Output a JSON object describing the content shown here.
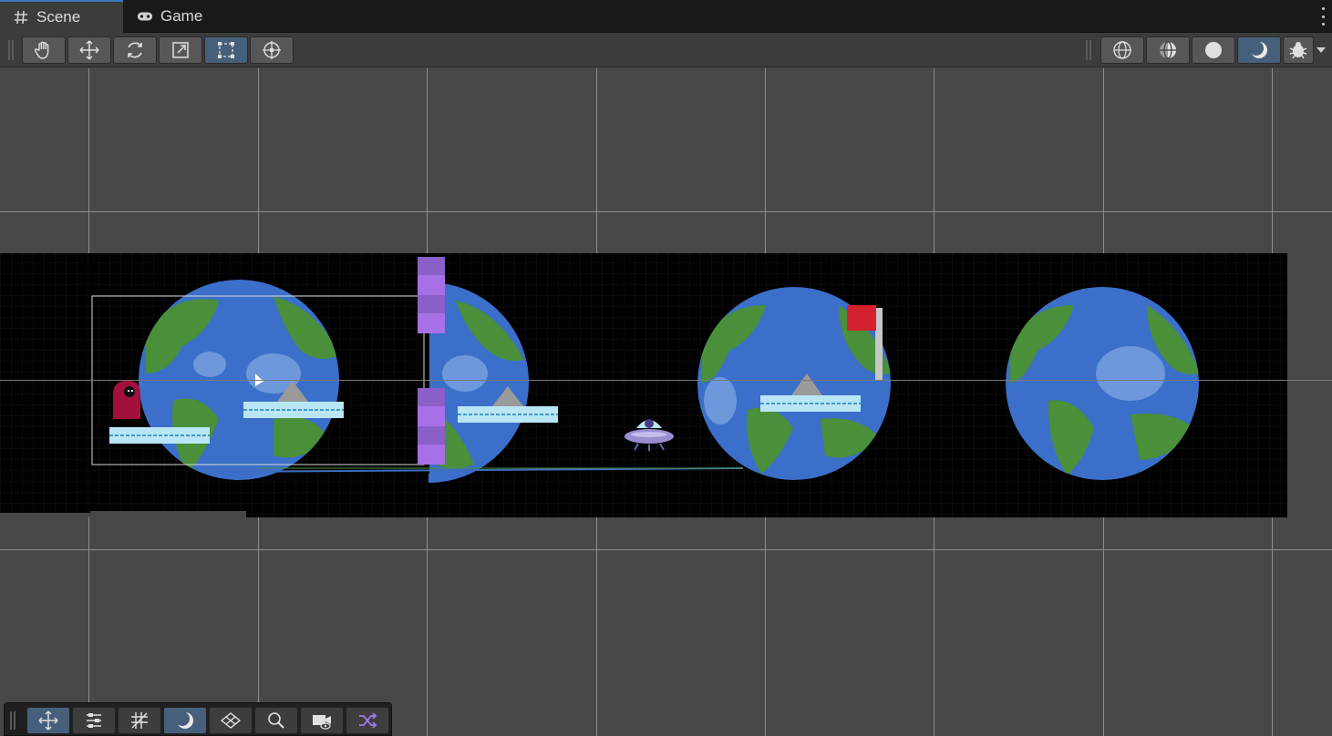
{
  "tabs": [
    {
      "label": "Scene",
      "icon": "hash-icon",
      "active": true
    },
    {
      "label": "Game",
      "icon": "gamepad-icon",
      "active": false
    }
  ],
  "toolbar": {
    "left_tools": [
      {
        "name": "hand-tool",
        "icon": "hand-icon",
        "active": false
      },
      {
        "name": "move-tool",
        "icon": "move-arrows-icon",
        "active": false
      },
      {
        "name": "rotate-tool",
        "icon": "rotate-icon",
        "active": false
      },
      {
        "name": "scale-tool",
        "icon": "scale-icon",
        "active": false
      },
      {
        "name": "rect-tool",
        "icon": "rect-transform-icon",
        "active": true
      },
      {
        "name": "transform-tool",
        "icon": "transform-icon",
        "active": false
      }
    ],
    "right_tools": [
      {
        "name": "wireframe-shading",
        "icon": "wireframe-sphere-icon",
        "active": false
      },
      {
        "name": "shaded-wireframe",
        "icon": "shaded-wireframe-icon",
        "active": false
      },
      {
        "name": "shaded",
        "icon": "solid-sphere-icon",
        "active": false
      },
      {
        "name": "unlit",
        "icon": "crescent-icon",
        "active": true
      },
      {
        "name": "debug-draw",
        "icon": "bug-icon",
        "active": false
      }
    ]
  },
  "overlay_toolbar": [
    {
      "name": "move-tool-overlay",
      "icon": "move-arrows-icon",
      "active": true
    },
    {
      "name": "tool-settings",
      "icon": "sliders-icon",
      "active": false
    },
    {
      "name": "grid-snapping",
      "icon": "grid-snap-icon",
      "active": false
    },
    {
      "name": "draw-mode",
      "icon": "crescent-icon",
      "active": true
    },
    {
      "name": "grid-visibility",
      "icon": "grid-plane-icon",
      "active": false
    },
    {
      "name": "search",
      "icon": "search-icon",
      "active": false
    },
    {
      "name": "camera-view",
      "icon": "camera-eye-icon",
      "active": false
    },
    {
      "name": "shuffle",
      "icon": "shuffle-icon",
      "active": true
    }
  ],
  "colors": {
    "accent": "#3a79bb",
    "active_button": "#46607c",
    "scene_background": "#000000",
    "earth_ocean": "#3b6fc9",
    "earth_land": "#4a8f3a",
    "player": "#a3103b",
    "flag": "#d4202f",
    "barrier": "#a870e6",
    "platform": "#b9e6f5"
  }
}
